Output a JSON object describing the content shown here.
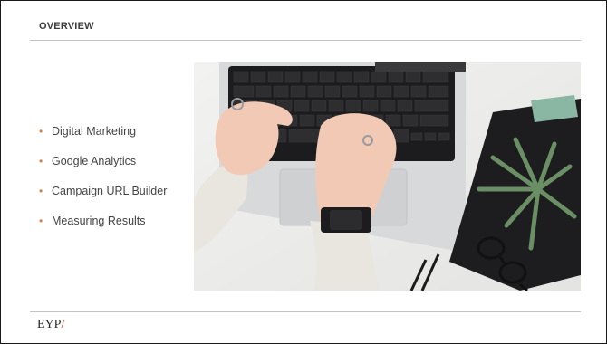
{
  "slide": {
    "title": "OVERVIEW",
    "bullets": [
      "Digital Marketing",
      "Google Analytics",
      "Campaign URL Builder",
      "Measuring Results"
    ],
    "logo": {
      "text": "EYP",
      "slash": "/"
    },
    "accent_color": "#e07b3c",
    "photo_description_icon": "laptop-typing-photo"
  }
}
